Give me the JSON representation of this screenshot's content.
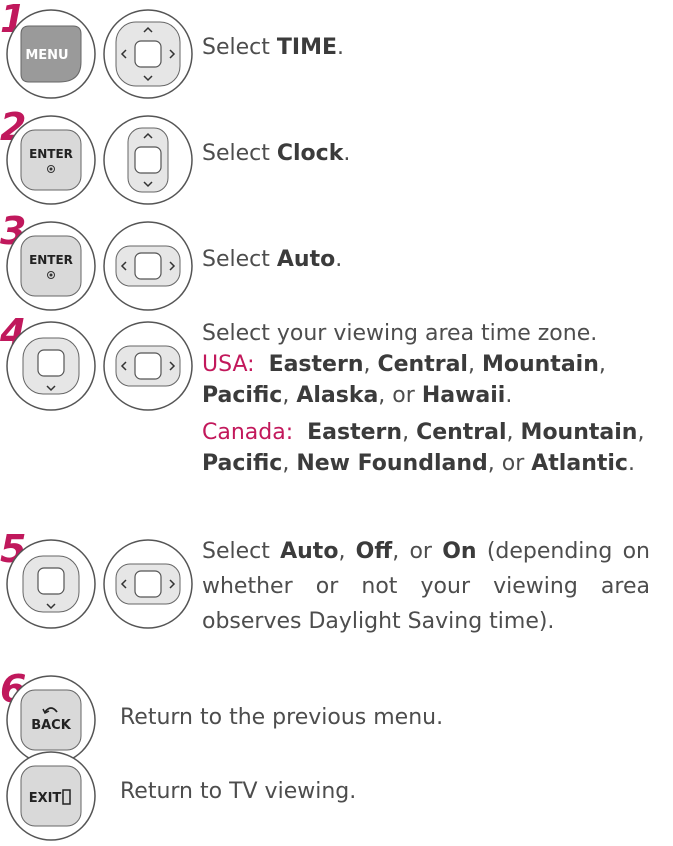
{
  "colors": {
    "step_number": "#c0185c",
    "region_label": "#c2185b",
    "button_fill": "#d9d9d9",
    "menu_fill": "#9a9a9a"
  },
  "steps": [
    {
      "number": "1",
      "buttons": [
        "MENU",
        "navigation-4way"
      ],
      "pre": "Select ",
      "bold": "TIME",
      "post": "."
    },
    {
      "number": "2",
      "buttons": [
        "ENTER",
        "navigation-updown"
      ],
      "pre": "Select ",
      "bold": "Clock",
      "post": "."
    },
    {
      "number": "3",
      "buttons": [
        "ENTER",
        "navigation-leftright"
      ],
      "pre": "Select ",
      "bold": "Auto",
      "post": "."
    },
    {
      "number": "4",
      "buttons": [
        "navigation-down",
        "navigation-leftright"
      ],
      "line1": "Select your viewing area time zone.",
      "usa_label": "USA:",
      "usa_zones": [
        "Eastern",
        "Central",
        "Mountain",
        "Pacific",
        "Alaska",
        "Hawaii"
      ],
      "canada_label": "Canada:",
      "canada_zones": [
        "Eastern",
        "Central",
        "Mountain",
        "Pacific",
        "New Foundland",
        "Atlantic"
      ],
      "or_word": "or"
    },
    {
      "number": "5",
      "buttons": [
        "navigation-down",
        "navigation-leftright"
      ],
      "pre": "Select ",
      "opt1": "Auto",
      "opt2": "Off",
      "opt3": "On",
      "post": " (depending on whether or not your viewing area observes Daylight Saving time)."
    },
    {
      "number": "6",
      "buttons": [
        "BACK"
      ],
      "text": "Return to the previous menu."
    },
    {
      "number": "",
      "buttons": [
        "EXIT"
      ],
      "text": "Return to TV viewing."
    }
  ],
  "labels": {
    "menu": "MENU",
    "enter": "ENTER",
    "back": "BACK",
    "exit": "EXIT"
  }
}
